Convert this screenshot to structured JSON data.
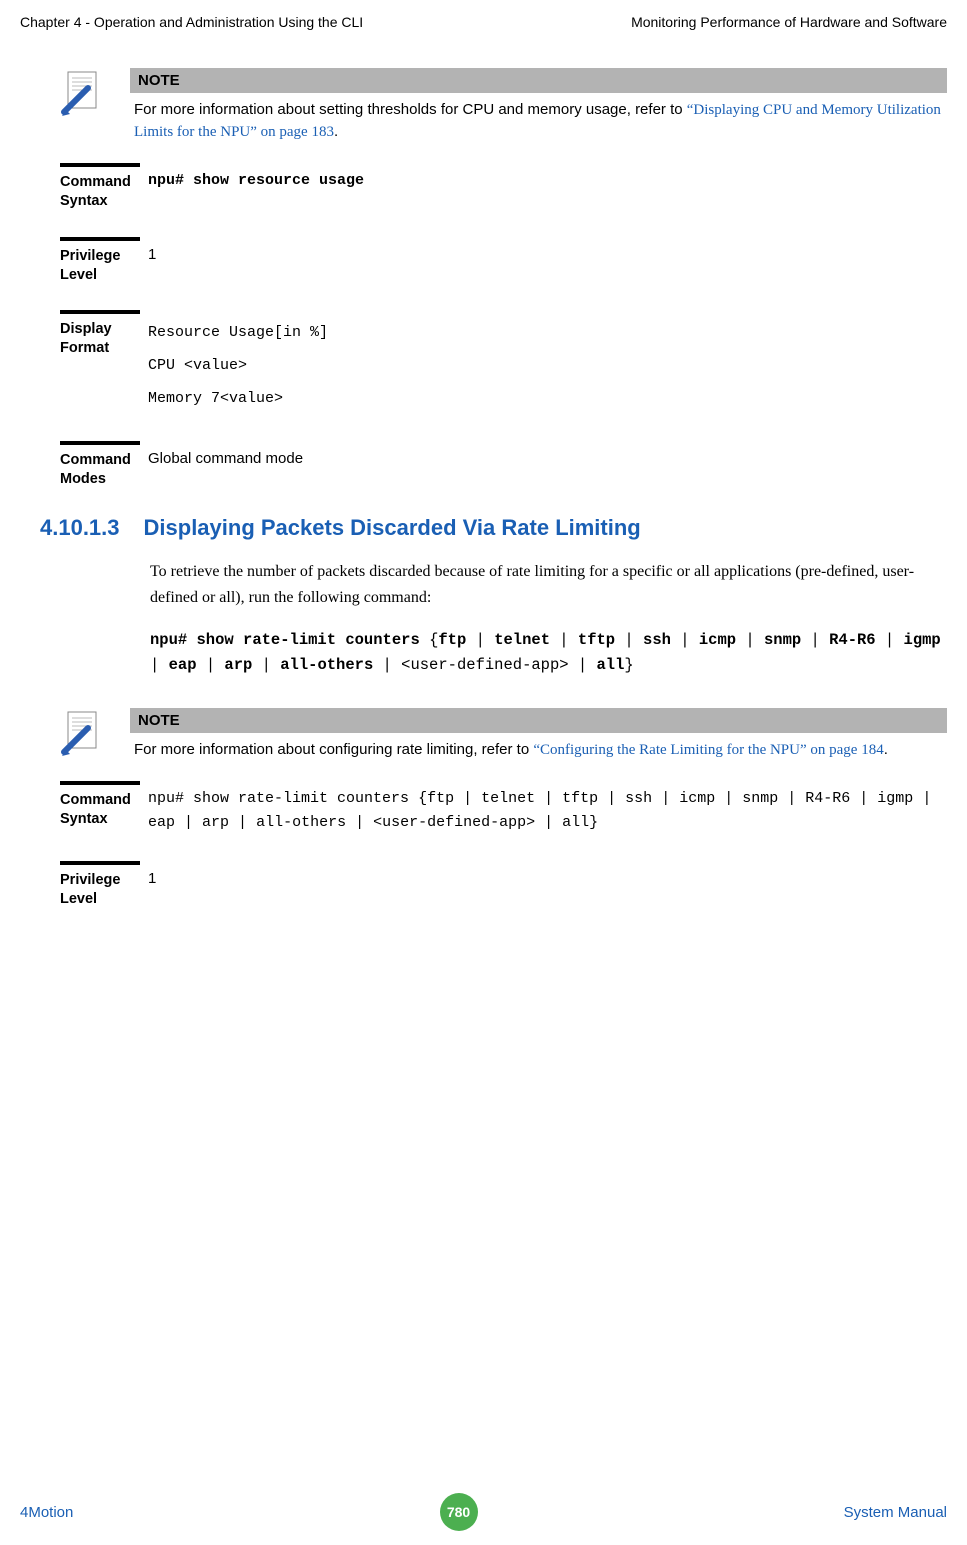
{
  "header": {
    "left": "Chapter 4 - Operation and Administration Using the CLI",
    "right": "Monitoring Performance of Hardware and Software"
  },
  "note1": {
    "label": "NOTE",
    "text_prefix": "For more information about setting thresholds for CPU and memory usage, refer to ",
    "link": "“Displaying CPU and Memory Utilization Limits for the NPU” on page 183",
    "text_suffix": "."
  },
  "defs1": {
    "command_syntax_label": "Command Syntax",
    "command_syntax_value": "npu# show resource usage",
    "privilege_level_label": "Privilege Level",
    "privilege_level_value": "1",
    "display_format_label": "Display Format",
    "display_format_line1": "Resource    Usage[in %]",
    "display_format_line2": "CPU          <value>",
    "display_format_line3": "Memory       7<value>",
    "command_modes_label": "Command Modes",
    "command_modes_value": "Global command mode"
  },
  "section": {
    "number": "4.10.1.3",
    "title": "Displaying Packets Discarded Via Rate Limiting"
  },
  "body1": "To retrieve the number of packets discarded because of rate limiting for a specific or all applications (pre-defined, user-defined or all), run the following command:",
  "cmd1": {
    "p1": "npu# show rate-limit counters",
    "p2": "{",
    "p3": "ftp",
    "p4": " | ",
    "p5": "telnet",
    "p6": " | ",
    "p7": "tftp",
    "p8": " | ",
    "p9": "ssh",
    "p10": " | ",
    "p11": "icmp",
    "p12": " | ",
    "p13": "snmp",
    "p14": " | ",
    "p15": "R4-R6",
    "p16": " | ",
    "p17": "igmp",
    "p18": " | ",
    "p19": "eap",
    "p20": " | ",
    "p21": "arp",
    "p22": " | ",
    "p23": "all-others",
    "p24": " | <user-defined-app> | ",
    "p25": "all",
    "p26": "}"
  },
  "note2": {
    "label": "NOTE",
    "text_prefix": "For more information about configuring rate limiting, refer to ",
    "link": "“Configuring the Rate Limiting for the NPU” on page 184",
    "text_suffix": "."
  },
  "defs2": {
    "command_syntax_label": "Command Syntax",
    "privilege_level_label": "Privilege Level",
    "privilege_level_value": "1"
  },
  "footer": {
    "left": "4Motion",
    "page": "780",
    "right": "System Manual"
  }
}
